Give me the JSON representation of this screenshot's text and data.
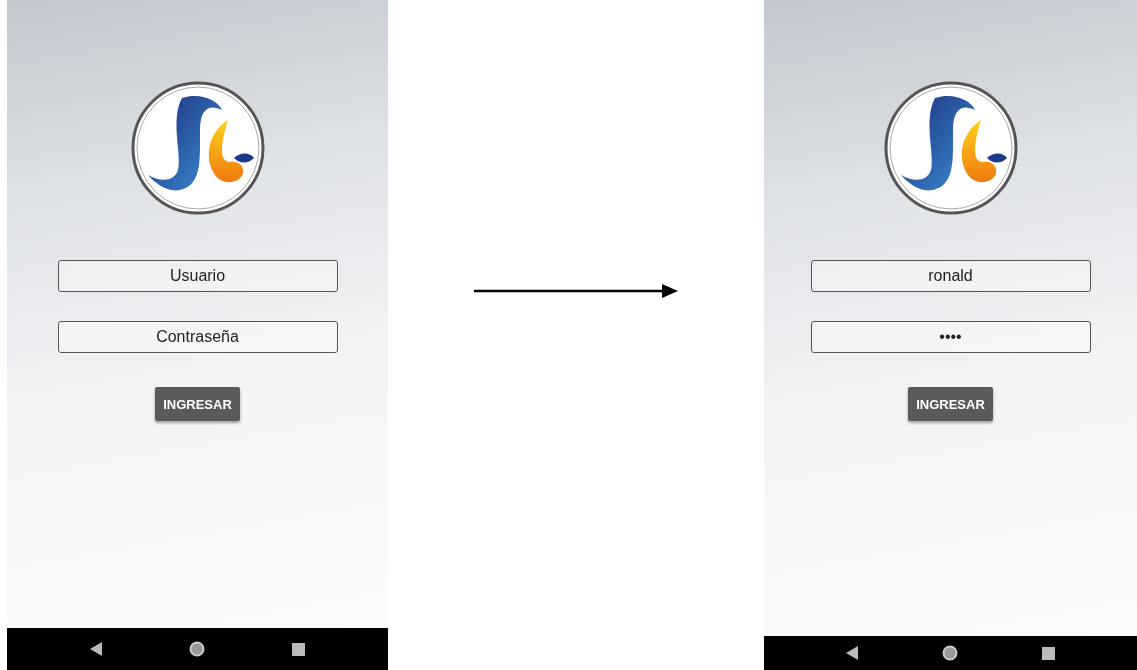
{
  "screens": [
    {
      "fields": [
        {
          "placeholder": "Usuario"
        },
        {
          "placeholder": "Contraseña"
        }
      ],
      "button": "INGRESAR"
    },
    {
      "fields": [
        {
          "value": "ronald"
        },
        {
          "value": "••••"
        }
      ],
      "button": "INGRESAR"
    }
  ]
}
